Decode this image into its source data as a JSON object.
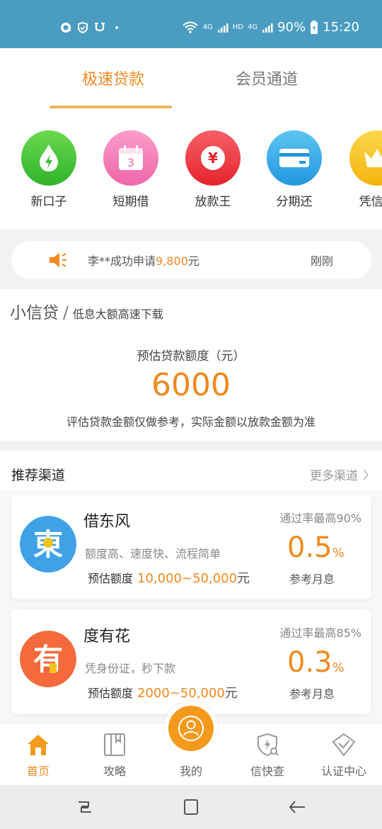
{
  "status_bar": {
    "signal_text": "4G",
    "hd_text": "HD",
    "battery": "90%",
    "time": "15:20"
  },
  "tabs": {
    "active": "极速贷款",
    "member": "会员通道"
  },
  "categories": [
    {
      "label": "新口子",
      "icon": "water-drop-icon",
      "color": "#4cc63c"
    },
    {
      "label": "短期借",
      "icon": "calendar-icon",
      "color": "#f27fb5",
      "badge": "3"
    },
    {
      "label": "放款王",
      "icon": "yen-icon",
      "color": "#ef3f48",
      "badge": "¥"
    },
    {
      "label": "分期还",
      "icon": "card-icon",
      "color": "#35a9e6"
    },
    {
      "label": "凭信用",
      "icon": "crown-icon",
      "color": "#f6c31f"
    }
  ],
  "notice": {
    "prefix": "李**成功申请",
    "amount": "9,800",
    "suffix": "元",
    "time": "刚刚"
  },
  "estimate": {
    "product": "小信贷",
    "slash": "/",
    "subtitle": "低息大额高速下载",
    "label": "预估贷款额度（元）",
    "value": "6000",
    "note": "评估贷款金额仅做参考，实际金额以放款金额为准"
  },
  "recommend": {
    "title": "推荐渠道",
    "more": "更多渠道",
    "cards": [
      {
        "name": "借东风",
        "logo_char": "東",
        "logo_color": "#3fa2e6",
        "desc": "额度高、速度快、流程简单",
        "quota_label": "预估额度",
        "quota_value": "10,000~50,000",
        "quota_unit": "元",
        "pass_rate": "通过率最高90%",
        "rate": "0.5",
        "rate_unit": "%",
        "rate_label": "参考月息"
      },
      {
        "name": "度有花",
        "logo_char": "有",
        "logo_color": "#f46a3c",
        "desc": "凭身份证，秒下款",
        "quota_label": "预估额度",
        "quota_value": "2000~50,000",
        "quota_unit": "元",
        "pass_rate": "通过率最高85%",
        "rate": "0.3",
        "rate_unit": "%",
        "rate_label": "参考月息"
      }
    ]
  },
  "bottom_nav": {
    "home": "首页",
    "guide": "攻略",
    "mine": "我的",
    "credit_check": "信快查",
    "certification": "认证中心"
  },
  "colors": {
    "accent": "#f0891e",
    "status_bar": "#4a9cc0"
  }
}
